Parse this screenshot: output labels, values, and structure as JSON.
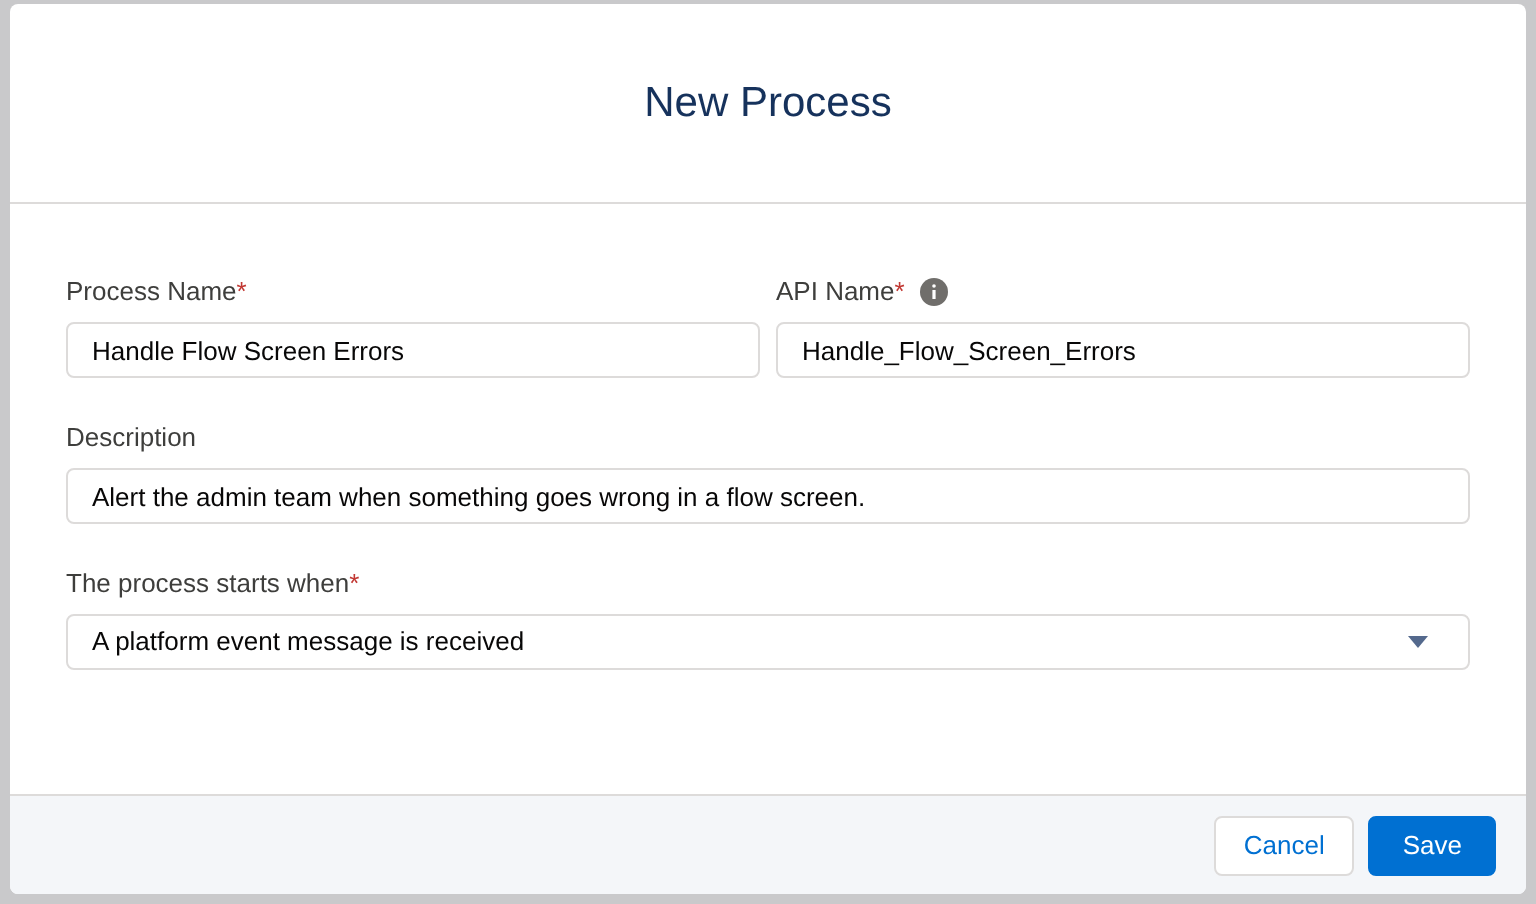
{
  "dialog": {
    "title": "New Process",
    "fields": [
      {
        "kind": "text",
        "label": "Process Name",
        "required_mark": "*",
        "info": false,
        "value": "Handle Flow Screen Errors"
      },
      {
        "kind": "text",
        "label": "API Name",
        "required_mark": "*",
        "info": true,
        "value": "Handle_Flow_Screen_Errors"
      },
      {
        "kind": "text",
        "label": "Description",
        "info": false,
        "value": "Alert the admin team when something goes wrong in a flow screen."
      },
      {
        "kind": "select",
        "label": "The process starts when",
        "required_mark": "*",
        "info": false,
        "value": "A platform event message is received"
      }
    ],
    "buttons": [
      {
        "label": "Cancel",
        "kind": "neutral"
      },
      {
        "label": "Save",
        "kind": "brand"
      }
    ]
  }
}
